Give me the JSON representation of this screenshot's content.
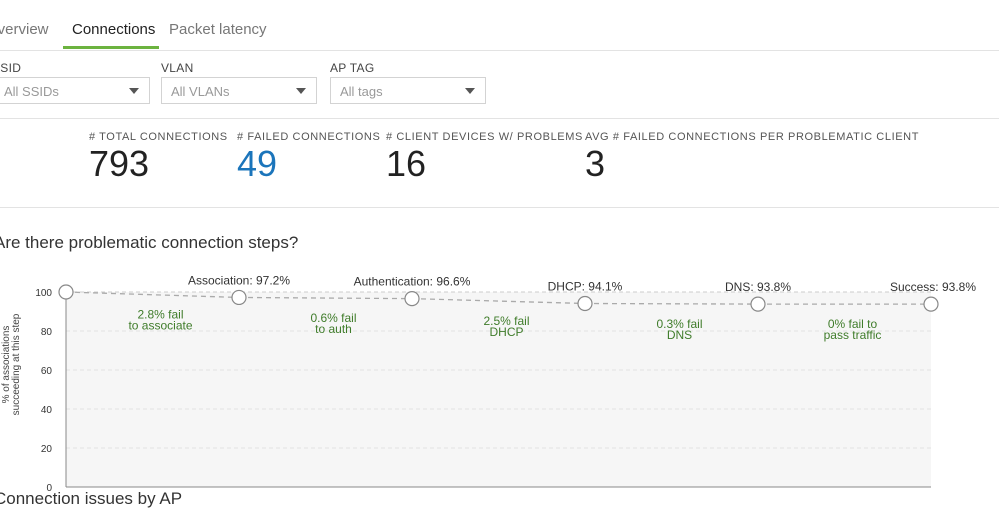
{
  "tabs": [
    {
      "label": "Overview",
      "active": false
    },
    {
      "label": "Connections",
      "active": true
    },
    {
      "label": "Packet latency",
      "active": false
    }
  ],
  "filters": [
    {
      "label": "SSID",
      "value": "All SSIDs"
    },
    {
      "label": "VLAN",
      "value": "All VLANs"
    },
    {
      "label": "AP TAG",
      "value": "All tags"
    }
  ],
  "stats": [
    {
      "label": "# TOTAL CONNECTIONS",
      "value": "793"
    },
    {
      "label": "# FAILED CONNECTIONS",
      "value": "49"
    },
    {
      "label": "# CLIENT DEVICES W/ PROBLEMS",
      "value": "16"
    },
    {
      "label": "AVG # FAILED CONNECTIONS PER PROBLEMATIC CLIENT",
      "value": "3"
    }
  ],
  "sections": {
    "steps_title": "Are there problematic connection steps?",
    "issues_title": "Connection issues by AP"
  },
  "colors": {
    "accent": "#6cb33f",
    "failed_blue": "#1b75bb",
    "fail_text": "#3f7c2a"
  },
  "chart_data": {
    "type": "line",
    "ylabel": "% of associations succeeding at this step",
    "ylabel_lines": [
      "% of associations",
      "succeeding at this step"
    ],
    "ylim": [
      0,
      100
    ],
    "yticks": [
      0,
      20,
      40,
      60,
      80,
      100
    ],
    "grid": true,
    "points": [
      {
        "label": "",
        "value": 100
      },
      {
        "label": "Association: 97.2%",
        "value": 97.2
      },
      {
        "label": "Authentication: 96.6%",
        "value": 96.6
      },
      {
        "label": "DHCP: 94.1%",
        "value": 94.1
      },
      {
        "label": "DNS: 93.8%",
        "value": 93.8
      },
      {
        "label": "Success: 93.8%",
        "value": 93.8
      }
    ],
    "fail_labels": [
      [
        "2.8% fail",
        "to associate"
      ],
      [
        "0.6% fail",
        "to auth"
      ],
      [
        "2.5% fail",
        "DHCP"
      ],
      [
        "0.3% fail",
        "DNS"
      ],
      [
        "0% fail to",
        "pass traffic"
      ]
    ]
  }
}
